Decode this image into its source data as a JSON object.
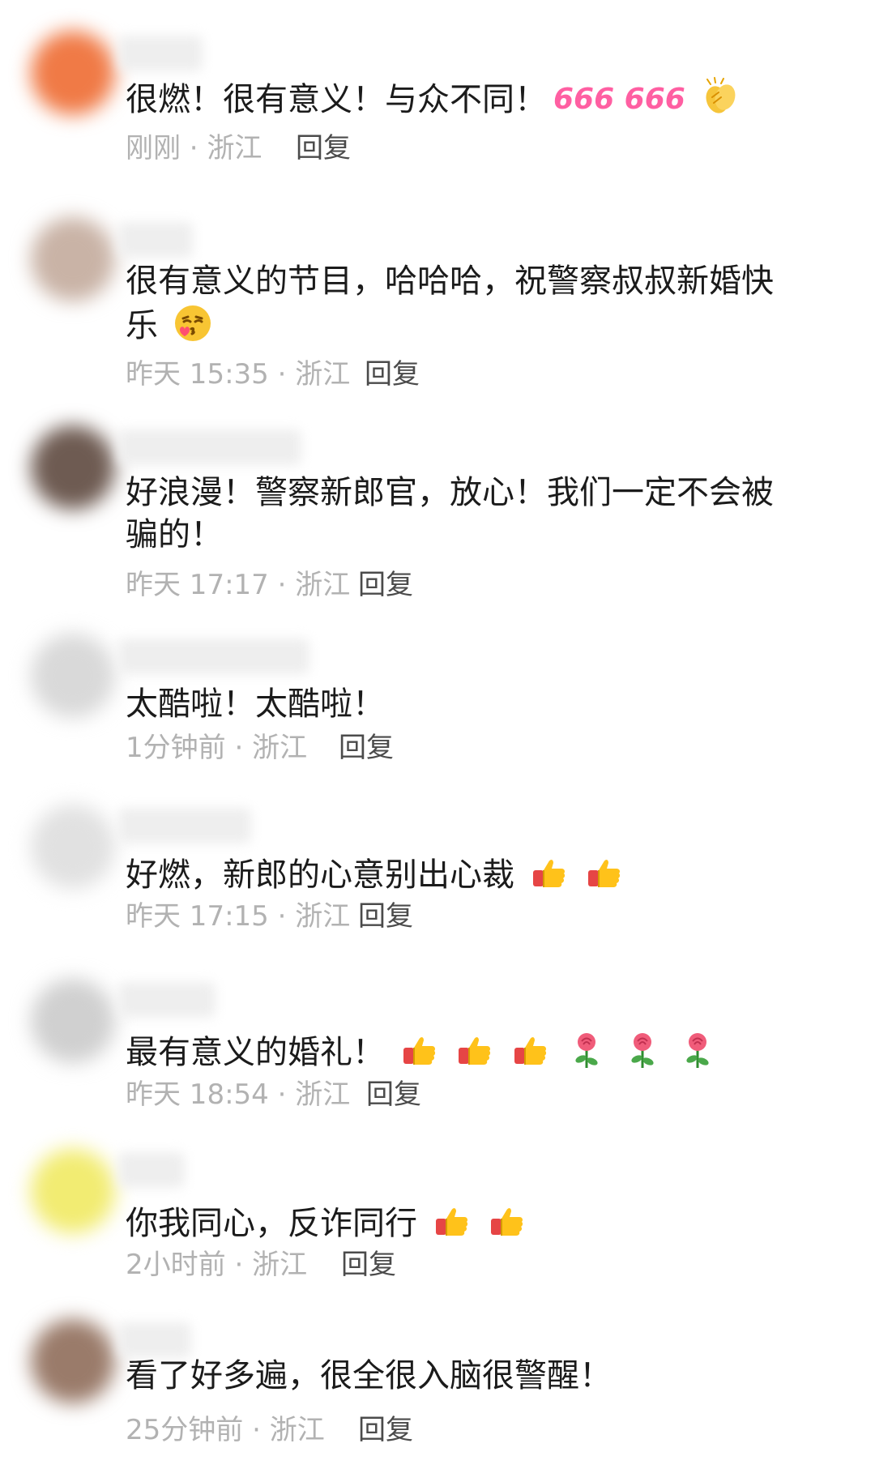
{
  "comments": [
    {
      "text": "很燃！很有意义！与众不同！",
      "emoji_text": "666 666",
      "emojis": [
        "clapping-hands"
      ],
      "time": "刚刚",
      "location": "浙江",
      "reply": "回复",
      "avatar_color": "#f07a46"
    },
    {
      "text": "很有意义的节目，哈哈哈，祝警察叔叔新婚快乐",
      "emojis": [
        "blowing-kiss"
      ],
      "time": "昨天 15:35",
      "location": "浙江",
      "reply": "回复",
      "avatar_color": "#c9b3a6"
    },
    {
      "text": "好浪漫！警察新郎官，放心！我们一定不会被骗的！",
      "emojis": [],
      "time": "昨天 17:17",
      "location": "浙江",
      "reply": "回复",
      "avatar_color": "#6e5b52"
    },
    {
      "text": "太酷啦！太酷啦！",
      "emojis": [],
      "time": "1分钟前",
      "location": "浙江",
      "reply": "回复",
      "avatar_color": "#d9d9d9"
    },
    {
      "text": "好燃，新郎的心意别出心裁",
      "emojis": [
        "thumbs-up",
        "thumbs-up"
      ],
      "time": "昨天 17:15",
      "location": "浙江",
      "reply": "回复",
      "avatar_color": "#e1e1e1"
    },
    {
      "text": "最有意义的婚礼！",
      "emojis": [
        "thumbs-up",
        "thumbs-up",
        "thumbs-up",
        "rose",
        "rose",
        "rose"
      ],
      "time": "昨天 18:54",
      "location": "浙江",
      "reply": "回复",
      "avatar_color": "#d0d0d0"
    },
    {
      "text": "你我同心，反诈同行",
      "emojis": [
        "thumbs-up",
        "thumbs-up"
      ],
      "time": "2小时前",
      "location": "浙江",
      "reply": "回复",
      "avatar_color": "#f2ec72"
    },
    {
      "text": "看了好多遍，很全很入脑很警醒！",
      "emojis": [],
      "time": "25分钟前",
      "location": "浙江",
      "reply": "回复",
      "avatar_color": "#9a7b6a"
    }
  ]
}
